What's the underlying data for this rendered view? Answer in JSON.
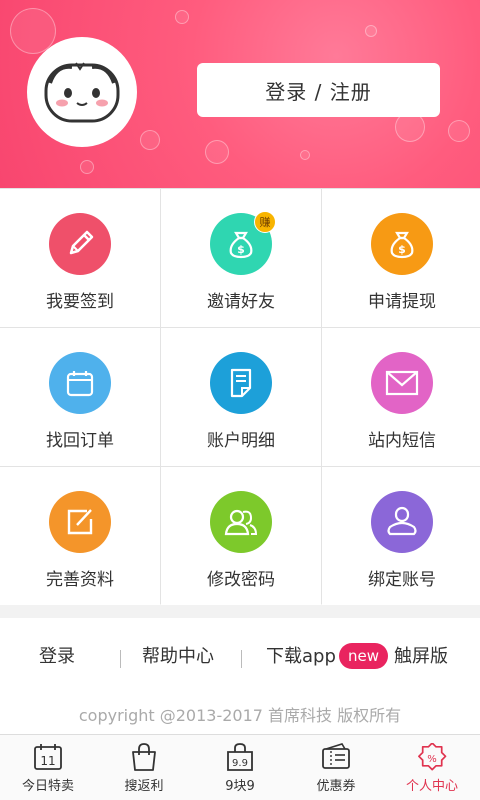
{
  "header": {
    "login_label": "登录 / 注册",
    "avatar": "panda-avatar",
    "bg_color": "#fb5b7d"
  },
  "menu": [
    {
      "label": "我要签到",
      "icon": "pencil-icon",
      "color": "#ef506a"
    },
    {
      "label": "邀请好友",
      "icon": "money-bag-icon",
      "color": "#2fd6b1",
      "badge": "赚"
    },
    {
      "label": "申请提现",
      "icon": "money-bag-icon",
      "color": "#f79a14"
    },
    {
      "label": "找回订单",
      "icon": "calendar-icon",
      "color": "#4fb1ec"
    },
    {
      "label": "账户明细",
      "icon": "document-icon",
      "color": "#1da0d9"
    },
    {
      "label": "站内短信",
      "icon": "envelope-icon",
      "color": "#e264c6"
    },
    {
      "label": "完善资料",
      "icon": "edit-icon",
      "color": "#f4952a"
    },
    {
      "label": "修改密码",
      "icon": "users-icon",
      "color": "#7dc92b"
    },
    {
      "label": "绑定账号",
      "icon": "person-icon",
      "color": "#8b67d8"
    }
  ],
  "footer": {
    "login": "登录",
    "help": "帮助中心",
    "download": "下载app",
    "new_badge": "new",
    "touch": "触屏版",
    "copyright": "copyright @2013-2017 首席科技  版权所有"
  },
  "tabs": [
    {
      "label": "今日特卖",
      "icon": "calendar-11-icon",
      "day": "11"
    },
    {
      "label": "搜返利",
      "icon": "shopping-bag-icon"
    },
    {
      "label": "9块9",
      "icon": "bag-99-icon",
      "tag": "9.9"
    },
    {
      "label": "优惠券",
      "icon": "coupon-icon"
    },
    {
      "label": "个人中心",
      "icon": "percent-badge-icon",
      "active": true
    }
  ]
}
